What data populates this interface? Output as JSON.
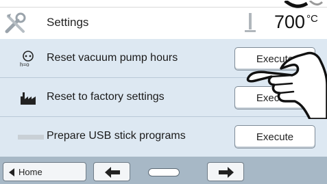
{
  "header": {
    "title": "Settings",
    "temperature_value": "700",
    "temperature_unit": "°C",
    "tools_icon": "tools-icon",
    "thermometer_icon": "thermometer-icon"
  },
  "rows": [
    {
      "icon": "vacuum-pump-icon",
      "label": "Reset vacuum pump hours",
      "button": "Execute"
    },
    {
      "icon": "factory-icon",
      "label": "Reset to factory settings",
      "button": "Execute"
    },
    {
      "icon": "usb-stick-icon",
      "label": "Prepare USB stick programs",
      "button": "Execute"
    }
  ],
  "nav": {
    "home_label": "Home",
    "back_icon": "arrow-left-icon",
    "forward_icon": "arrow-right-icon",
    "page_indicator_icon": "page-indicator"
  },
  "colors": {
    "row_background": "#dde8f2",
    "nav_background": "#a7b8c6"
  }
}
